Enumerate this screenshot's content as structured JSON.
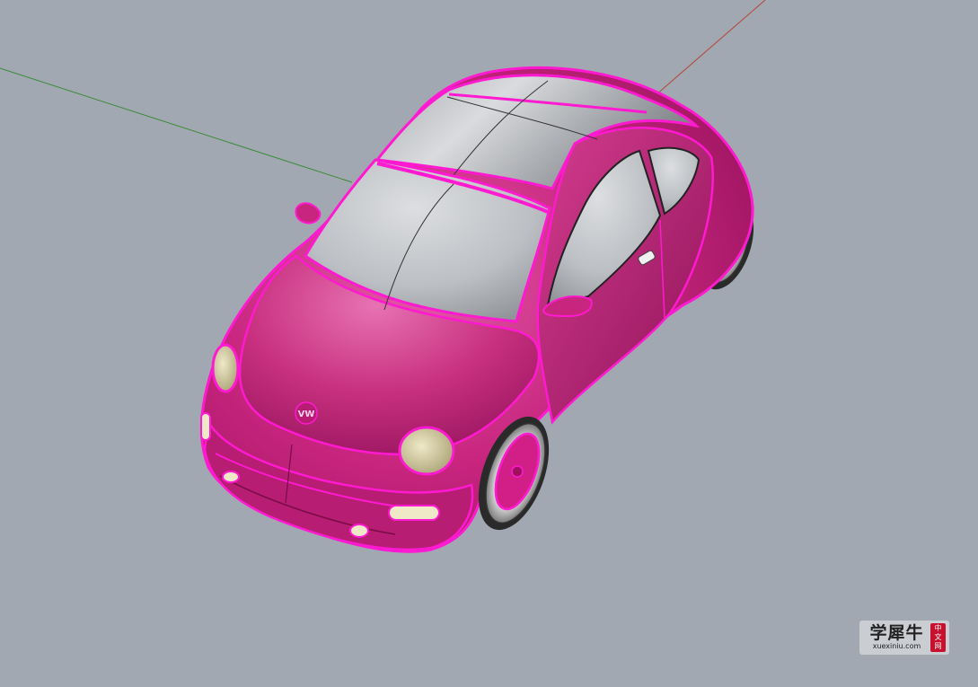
{
  "viewport": {
    "background": "#a2a8b1",
    "axes": {
      "x_color": "#b4463a",
      "y_color": "#3a8a3a"
    },
    "model": {
      "object": "car",
      "body_color": "#c8257e",
      "edge_highlight_color": "#ff19d0",
      "glass_color": "#c7c9cc",
      "headlight_color": "#d6cfa6"
    },
    "logo_text": "VW"
  },
  "watermark": {
    "title": "学犀牛",
    "subtitle": "xuexiniu.com",
    "seal": [
      "中",
      "文",
      "网"
    ]
  }
}
